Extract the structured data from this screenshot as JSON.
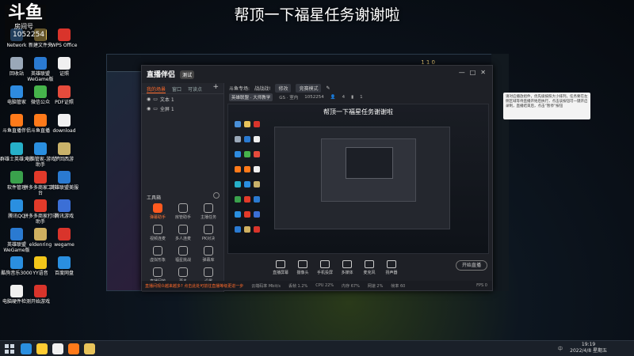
{
  "overlay": {
    "title": "帮顶一下福星任务谢谢啦"
  },
  "room": {
    "logo": "斗鱼",
    "label": "房间号",
    "number": "1052254"
  },
  "desktop_icons": [
    {
      "label": "Network",
      "color": "#4a90d9"
    },
    {
      "label": "新建文件夹",
      "color": "#e8c35a"
    },
    {
      "label": "WPS Office",
      "color": "#d9342b"
    },
    {
      "label": "回收站",
      "color": "#9aa8b8"
    },
    {
      "label": "英雄联盟WeGame版",
      "color": "#2a7ad1"
    },
    {
      "label": "证照",
      "color": "#f0f0f0"
    },
    {
      "label": "电脑管家",
      "color": "#2e8be0"
    },
    {
      "label": "微信公众",
      "color": "#46b34b"
    },
    {
      "label": "PDF证照",
      "color": "#e64b3c"
    },
    {
      "label": "斗鱼直播伴侣",
      "color": "#ff7a1a"
    },
    {
      "label": "斗鱼直播",
      "color": "#ff7a1a"
    },
    {
      "label": "download",
      "color": "#f0f0f0"
    },
    {
      "label": "群雄士英雄大师",
      "color": "#26b0c9"
    },
    {
      "label": "电脑管家-游戏助手",
      "color": "#2a8fe0"
    },
    {
      "label": "梦回西游",
      "color": "#c9b26a"
    },
    {
      "label": "软件管理",
      "color": "#3aa14c"
    },
    {
      "label": "拼多多商家工作台",
      "color": "#e23a2a"
    },
    {
      "label": "英雄联盟美服",
      "color": "#2a7ad1"
    },
    {
      "label": "腾讯QQ",
      "color": "#2a8fe0"
    },
    {
      "label": "拼多多商家打印助手",
      "color": "#e23a2a"
    },
    {
      "label": "腾讯游戏",
      "color": "#3b6fd6"
    },
    {
      "label": "英雄联盟WeGame版",
      "color": "#2a7ad1"
    },
    {
      "label": "eldenring",
      "color": "#d0b060"
    },
    {
      "label": "wegame",
      "color": "#d9342b"
    },
    {
      "label": "酷狗音乐3000",
      "color": "#2a8fe0"
    },
    {
      "label": "YY语音",
      "color": "#f2c61a"
    },
    {
      "label": "百度网盘",
      "color": "#2a8fe0"
    },
    {
      "label": "电脑硬件检测",
      "color": "#f0f0f0"
    },
    {
      "label": "开始游戏",
      "color": "#d9342b"
    }
  ],
  "game_window": {
    "gold": "1 1 0"
  },
  "app": {
    "logo": "直播伴侣",
    "version_badge": "测试",
    "window_controls": [
      "—",
      "□",
      "✕"
    ],
    "sidebar_tabs": [
      "我的场景",
      "窗口",
      "可读点"
    ],
    "sources": [
      "文本 1",
      "全屏 1"
    ],
    "tools_title": "工具箱",
    "tools": [
      {
        "label": "弹幕助手",
        "hot": true
      },
      {
        "label": "房管助手",
        "hot": false
      },
      {
        "label": "主播任务",
        "hot": false
      },
      {
        "label": "视频连麦",
        "hot": false
      },
      {
        "label": "多人连麦",
        "hot": false
      },
      {
        "label": "PK对决",
        "hot": false
      },
      {
        "label": "虚拟形象",
        "hot": false
      },
      {
        "label": "福星挑战",
        "hot": false
      },
      {
        "label": "弹幕库",
        "hot": false
      },
      {
        "label": "直播回放",
        "hot": false
      },
      {
        "label": "更多",
        "hot": false
      },
      {
        "label": "设置",
        "hot": false
      }
    ],
    "scene_bar": {
      "label": "斗鱼专场:",
      "scene": "战战战!",
      "edit": "修改",
      "mode": "竞赛模式",
      "edit_icon": "edit-icon"
    },
    "info_bar": {
      "room": "英雄联盟 · 大师教学",
      "extra": "GS · 室内",
      "id": "1052254",
      "count": "4",
      "hot": "1"
    },
    "preview_title": "帮顶一下福星任务谢谢啦",
    "tooltip": "请对应播放组件，优先级按照大小排列，任务要在左侧区域等待直播开始后执行，点击该按钮可一键开启录制，直播结束后，点击“暂停”按钮",
    "controls": [
      {
        "label": "直播屏幕"
      },
      {
        "label": "摄像头"
      },
      {
        "label": "手机投屏"
      },
      {
        "label": "多媒体"
      },
      {
        "label": "麦克风"
      },
      {
        "label": "扬声器"
      }
    ],
    "go_live": "开始直播",
    "status": {
      "warning": "直播间观众越来越多? 点击此处可前往直播等级更进一步",
      "items": [
        "云端码率 Mbit/s",
        "丢帧 1.2%",
        "CPU 22%",
        "内存 67%",
        "网速 2%",
        "帧率 60"
      ],
      "fps": "FPS 0"
    }
  },
  "taskbar": {
    "apps": [
      "#2a8fe0",
      "#ffcc33",
      "#f0f0f0",
      "#ff7a1a",
      "#e8c35a"
    ],
    "tray": "中 ",
    "time": "19:19",
    "date": "2022/4/8 星期五"
  }
}
